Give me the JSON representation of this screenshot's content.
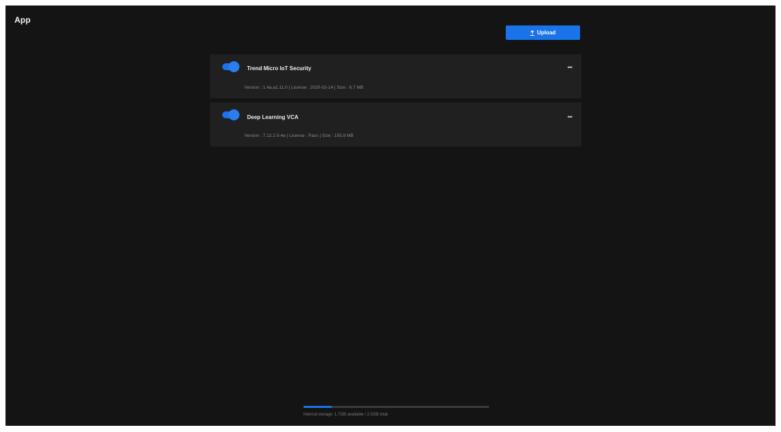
{
  "header": {
    "title": "App"
  },
  "toolbar": {
    "upload_label": "Upload",
    "upload_icon": "upload-icon"
  },
  "apps": [
    {
      "name": "Trend Micro IoT Security",
      "enabled": true,
      "meta": "Version : 1.4a.a1.11.0 | License : 2020-02-14 | Size : 6.7 MB",
      "more_icon": "more-horizontal-icon"
    },
    {
      "name": "Deep Learning VCA",
      "enabled": true,
      "meta": "Version : 7.12.2.5-4e | License : Pass | Size : 155.8 MB",
      "more_icon": "more-horizontal-icon"
    }
  ],
  "storage": {
    "used_fraction": 0.15,
    "text": "Internal storage: 1.7GB available / 2.0GB total"
  },
  "colors": {
    "background": "#141414",
    "card": "#202020",
    "accent": "#1a73e8"
  }
}
